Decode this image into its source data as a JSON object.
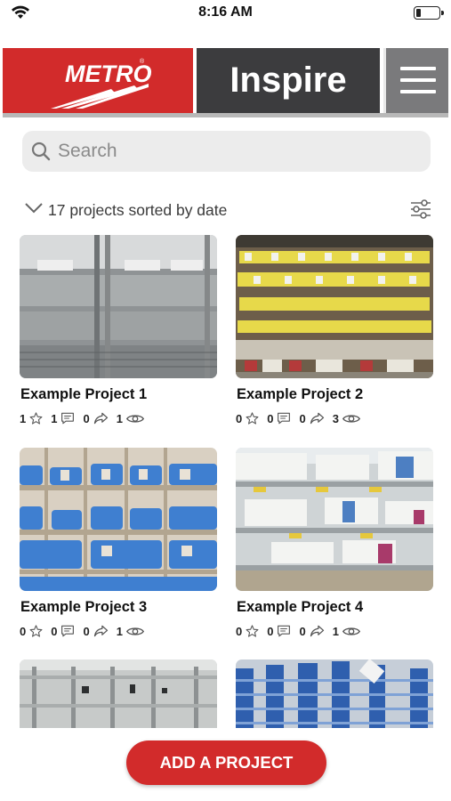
{
  "status_bar": {
    "time": "8:16 AM",
    "battery_percent": 20
  },
  "header": {
    "brand": "METRO",
    "title": "Inspire",
    "colors": {
      "brand_red": "#d22b2b",
      "title_bg": "#3c3c3e",
      "menu_bg": "#7a7a7c"
    }
  },
  "search": {
    "placeholder": "Search",
    "value": ""
  },
  "sort": {
    "label": "17 projects sorted by date"
  },
  "projects": [
    {
      "title": "Example Project 1",
      "stars": "1",
      "comments": "1",
      "shares": "0",
      "views": "1"
    },
    {
      "title": "Example Project 2",
      "stars": "0",
      "comments": "0",
      "shares": "0",
      "views": "3"
    },
    {
      "title": "Example Project 3",
      "stars": "0",
      "comments": "0",
      "shares": "0",
      "views": "1"
    },
    {
      "title": "Example Project 4",
      "stars": "0",
      "comments": "0",
      "shares": "0",
      "views": "1"
    },
    {
      "title": "",
      "stars": "",
      "comments": "",
      "shares": "",
      "views": ""
    },
    {
      "title": "",
      "stars": "",
      "comments": "",
      "shares": "",
      "views": ""
    }
  ],
  "icons": {
    "wifi": "wifi-icon",
    "battery": "battery-icon",
    "menu": "hamburger-menu-icon",
    "search": "search-icon",
    "chevron": "chevron-down-icon",
    "filter": "filter-sliders-icon",
    "star": "star-icon",
    "comment": "comment-icon",
    "share": "share-icon",
    "view": "eye-icon"
  },
  "actions": {
    "add_project_label": "ADD A PROJECT"
  }
}
